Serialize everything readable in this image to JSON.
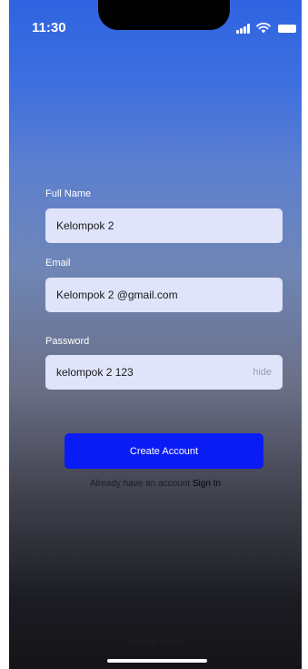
{
  "status_bar": {
    "time": "11:30",
    "icons": [
      "signal-icon",
      "wifi-icon",
      "battery-icon"
    ]
  },
  "form": {
    "full_name": {
      "label": "Full Name",
      "value": "Kelompok  2"
    },
    "email": {
      "label": "Email",
      "value": "Kelompok 2 @gmail.com"
    },
    "password": {
      "label": "Password",
      "value": "kelompok 2 123",
      "toggle_label": "hide"
    }
  },
  "actions": {
    "create_account_label": "Create Account",
    "signin_prompt": "Already have an account",
    "signin_link": "Sign In"
  },
  "footer": {
    "privacy_policy": "Privacy Policy"
  },
  "colors": {
    "accent": "#0a1cf5",
    "field_background": "#dfe4fb"
  }
}
